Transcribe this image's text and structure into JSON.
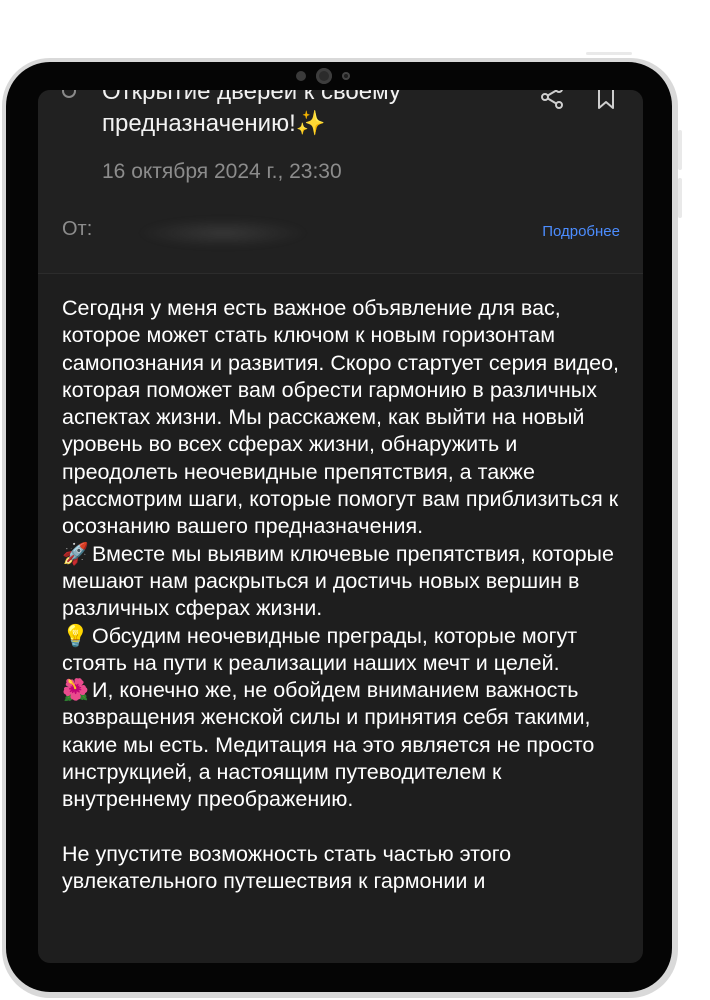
{
  "message": {
    "subject": "Открытие дверей к своему предназначению!",
    "subject_emoji": "✨",
    "date": "16 октября 2024 г., 23:30",
    "from_label": "От:",
    "details_label": "Подробнее"
  },
  "body": {
    "paragraph_1": "Сегодня у меня есть важное объявление для вас, которое может стать ключом к новым горизонтам самопознания и развития. Скоро стартует серия видео, которая поможет вам обрести гармонию в различных аспектах жизни. Мы расскажем, как выйти на новый уровень во всех сферах жизни, обнаружить и преодолеть неочевидные препятствия, а также рассмотрим шаги, которые помогут вам приблизиться к осознанию вашего предназначения.",
    "bullet_1_emoji": "🚀",
    "bullet_1": "Вместе мы выявим ключевые препятствия, которые мешают нам раскрыться и достичь новых вершин в различных сферах жизни.",
    "bullet_2_emoji": "💡",
    "bullet_2": "Обсудим неочевидные преграды, которые могут стоять на пути к реализации наших мечт и целей.",
    "bullet_3_emoji": "🌺",
    "bullet_3": "И, конечно же, не обойдем вниманием важность возвращения женской силы и принятия себя такими, какие мы есть. Медитация на это является не просто инструкцией, а настоящим путеводителем к внутреннему преображению.",
    "paragraph_2": "Не упустите возможность стать частью этого увлекательного путешествия к гармонии и"
  },
  "icons": {
    "share": "share-icon",
    "bookmark": "bookmark-icon",
    "unread": "unread-dot-icon"
  },
  "colors": {
    "screen_background": "#1e1e1e",
    "text_primary": "#ffffff",
    "text_secondary": "#8c8c8c",
    "link": "#4c8dff"
  }
}
